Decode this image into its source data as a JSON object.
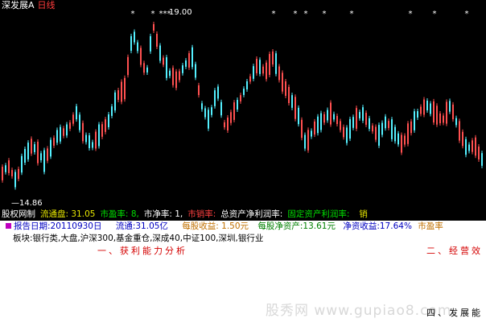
{
  "header": {
    "code": "深发展A",
    "period": "日线"
  },
  "chart": {
    "max_price": "19.00",
    "min_price": "14.86",
    "colors": {
      "up": "#ff5050",
      "down": "#54f0ff",
      "marker": "#ffffff"
    }
  },
  "info_row": [
    {
      "text": "股权网制",
      "color": "#ffffff"
    },
    {
      "text": "流通盘: 31.05",
      "color": "#e6e600"
    },
    {
      "text": "市盈率: 8,",
      "color": "#00e000"
    },
    {
      "text": "市净率: 1,",
      "color": "#ffffff"
    },
    {
      "text": "市销率:",
      "color": "#ff4040"
    },
    {
      "text": "总资产净利润率:",
      "color": "#ffffff"
    },
    {
      "text": "固定资产利润率:",
      "color": "#00e000"
    },
    {
      "text": "",
      "color": "#3030ff"
    },
    {
      "text": "销",
      "color": "#e6e600"
    }
  ],
  "report": {
    "date_label": "报告日期:20110930日",
    "float_label": "流通:31.05亿",
    "eps_label": "每股收益: 1.50元",
    "navps_label": "每股净资产:13.61元",
    "roe_label": "净资收益:17.64%",
    "pe_label": "市盈率"
  },
  "sectors": "板块:银行类,大盘,沪深300,基金重仓,深成40,中证100,深圳,银行业",
  "sections": {
    "profit": "一、获利能力分析",
    "operation": "二、经营效",
    "development": "四、发展能"
  },
  "watermark": "股秀网 www.gupiao8.com"
}
